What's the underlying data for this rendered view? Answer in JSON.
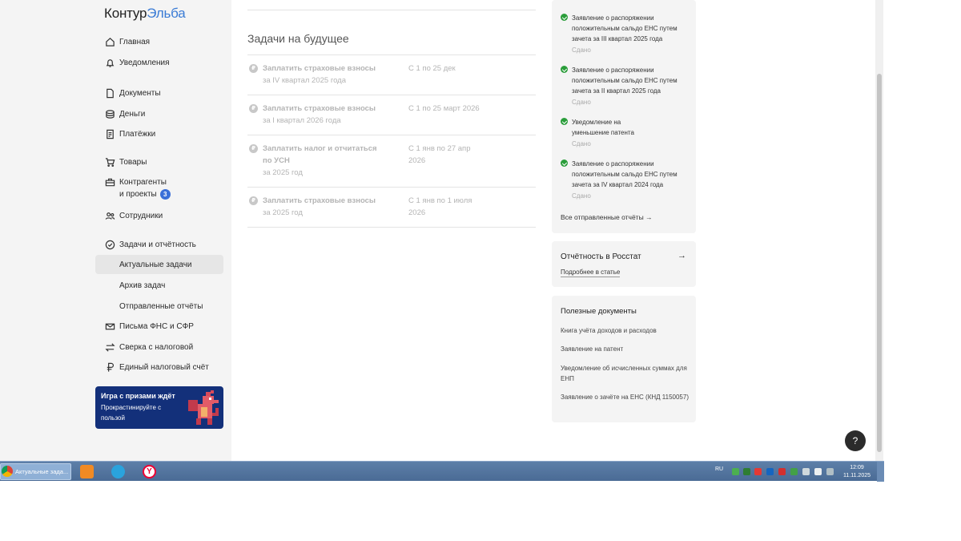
{
  "logo": {
    "part1": "Контур",
    "part2": "Эльба"
  },
  "sidebar": {
    "items": [
      {
        "label": "Главная",
        "icon": "home-icon"
      },
      {
        "label": "Уведомления",
        "icon": "bell-icon"
      },
      {
        "label": "Документы",
        "icon": "document-icon"
      },
      {
        "label": "Деньги",
        "icon": "coins-icon"
      },
      {
        "label": "Платёжки",
        "icon": "receipt-icon"
      },
      {
        "label": "Товары",
        "icon": "cart-icon"
      },
      {
        "label": "Контрагенты",
        "label2": "и проекты",
        "badge": "3",
        "icon": "briefcase-icon"
      },
      {
        "label": "Сотрудники",
        "icon": "people-icon"
      },
      {
        "label": "Задачи и отчётность",
        "icon": "check-circle-icon"
      },
      {
        "label": "Актуальные задачи"
      },
      {
        "label": "Архив задач"
      },
      {
        "label": "Отправленные отчёты"
      },
      {
        "label": "Письма ФНС и СФР",
        "icon": "mail-icon"
      },
      {
        "label": "Сверка с налоговой",
        "icon": "swap-icon"
      },
      {
        "label": "Единый налоговый счёт",
        "icon": "ruble-icon"
      }
    ]
  },
  "promo": {
    "title": "Игра с призами ждёт",
    "text": "Прокрастинируйте с пользой"
  },
  "main": {
    "section_title": "Задачи на будущее",
    "tasks": [
      {
        "title": "Заплатить страховые взносы",
        "subtitle": "за IV квартал 2025 года",
        "period": "С 1 по 25 дек"
      },
      {
        "title": "Заплатить страховые взносы",
        "subtitle": "за I квартал 2026 года",
        "period": "С 1 по 25 март 2026"
      },
      {
        "title": "Заплатить налог и отчитаться по УСН",
        "subtitle": "за 2025 год",
        "period": "С 1 янв по 27 апр 2026"
      },
      {
        "title": "Заплатить страховые взносы",
        "subtitle": "за 2025 год",
        "period": "С 1 янв по 1 июля 2026"
      }
    ]
  },
  "reports": {
    "items": [
      {
        "text": "Заявление о распоряжении положительным сальдо ЕНС путем зачета за III квартал 2025 года",
        "status": "Сдано"
      },
      {
        "text": "Заявление о распоряжении положительным сальдо ЕНС путем зачета за II квартал 2025 года",
        "status": "Сдано"
      },
      {
        "text": "Уведомление на уменьшение патента",
        "status": "Сдано"
      },
      {
        "text": "Заявление о распоряжении положительным сальдо ЕНС путем зачета за IV квартал 2024 года",
        "status": "Сдано"
      }
    ],
    "all_link": "Все отправленные отчёты"
  },
  "rosstat": {
    "title": "Отчётность в Росстат",
    "link": "Подробнее в статье"
  },
  "useful_docs": {
    "title": "Полезные документы",
    "items": [
      "Книга учёта доходов и расходов",
      "Заявление на патент",
      "Уведомление об исчисленных суммах для ЕНП",
      "Заявление о зачёте на ЕНС (КНД 1150057)"
    ]
  },
  "help": {
    "label": "?"
  },
  "taskbar": {
    "app_label": "Актуальные зада...",
    "lang": "RU",
    "time": "12:09",
    "date": "11.11.2025"
  },
  "colors": {
    "accent": "#3a7bd5",
    "badge": "#3a6fd8",
    "success": "#2a9d3a",
    "promo_bg": "#13307a"
  }
}
